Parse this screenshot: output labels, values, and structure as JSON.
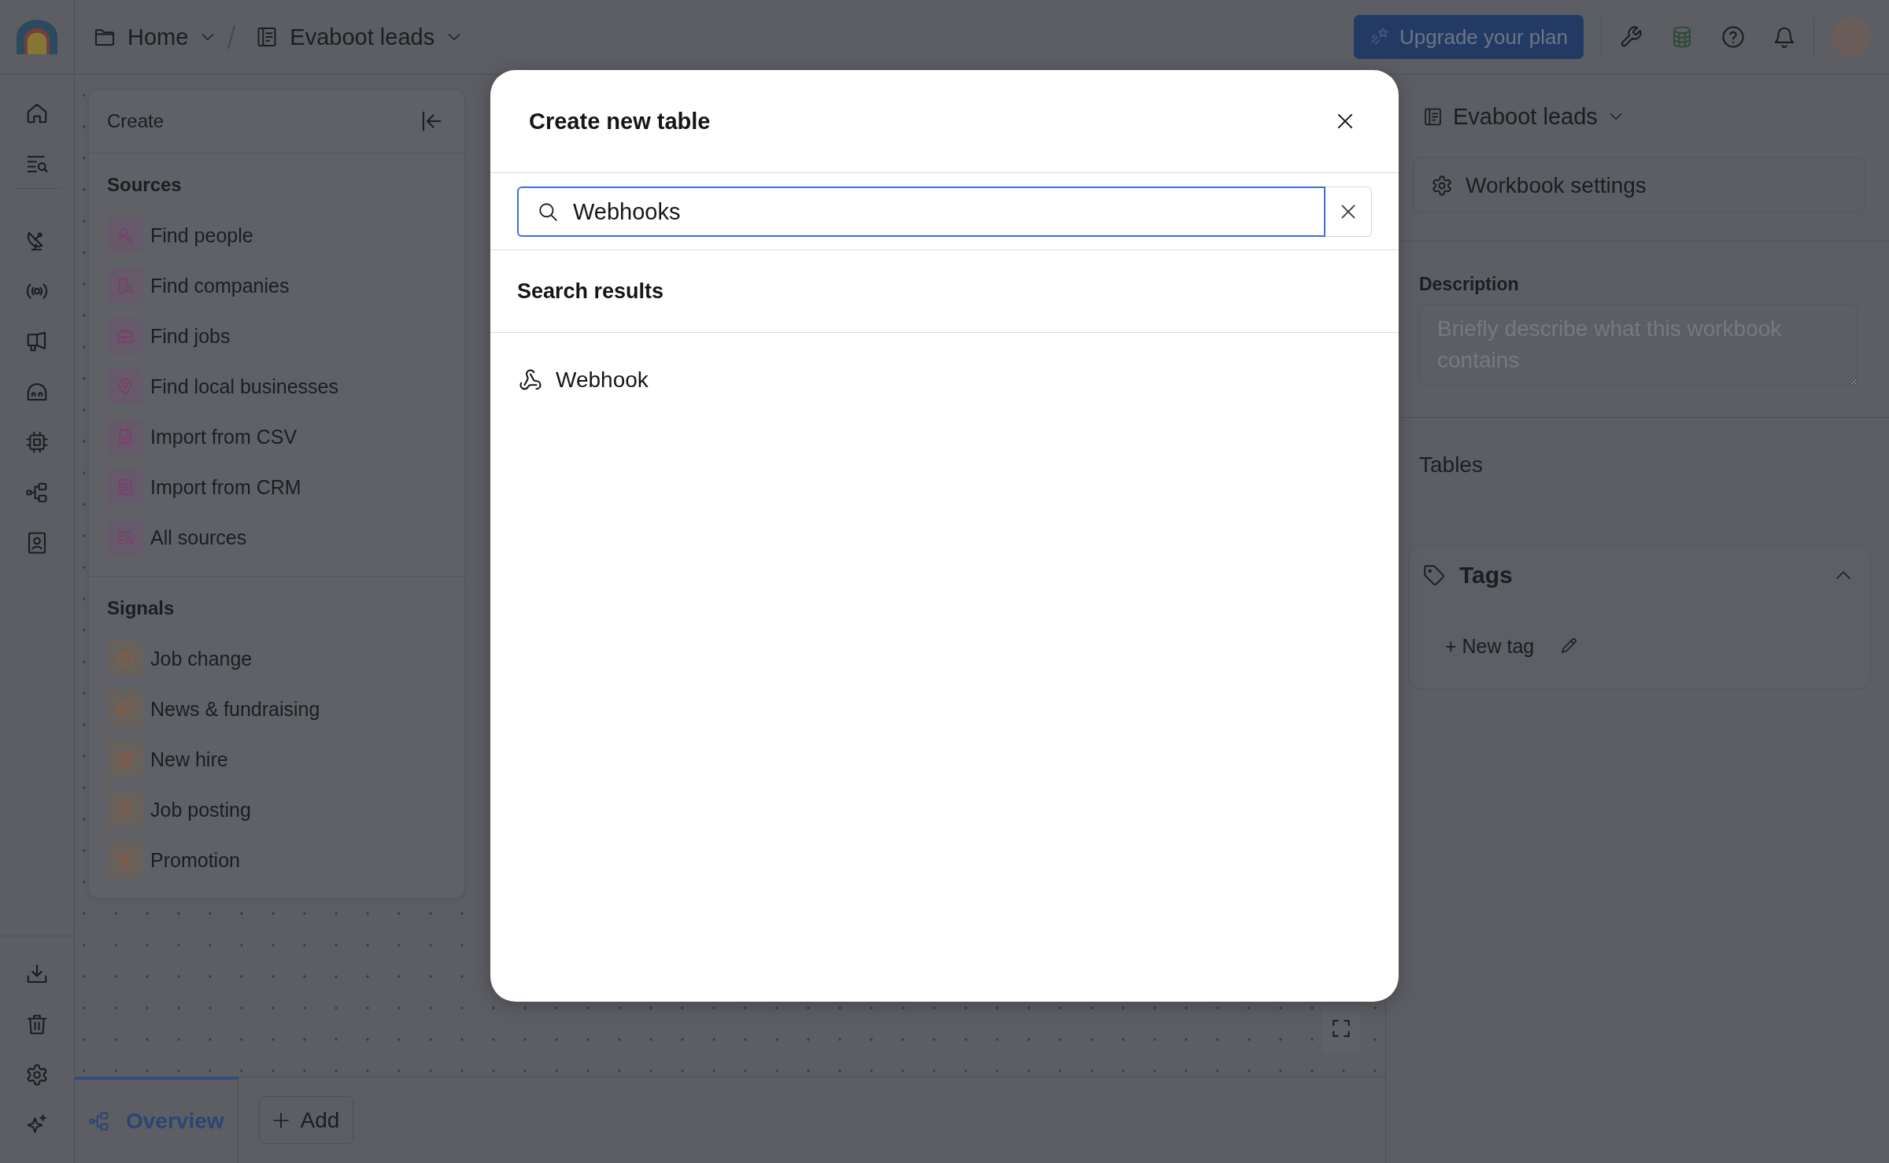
{
  "topbar": {
    "breadcrumb": [
      {
        "kind": "folder",
        "label": "Home"
      },
      {
        "kind": "notebook",
        "label": "Evaboot leads"
      }
    ],
    "upgrade_button": "Upgrade your plan"
  },
  "create_panel": {
    "title": "Create",
    "sections": [
      {
        "kind": "source",
        "title": "Sources",
        "items": [
          "Find people",
          "Find companies",
          "Find jobs",
          "Find local businesses",
          "Import from CSV",
          "Import from CRM",
          "All sources"
        ]
      },
      {
        "kind": "signal",
        "title": "Signals",
        "items": [
          "Job change",
          "News & fundraising",
          "New hire",
          "Job posting",
          "Promotion"
        ]
      }
    ]
  },
  "modal": {
    "title": "Create new table",
    "search": {
      "value": "Webhooks"
    },
    "results_heading": "Search results",
    "results": [
      {
        "label": "Webhook"
      }
    ]
  },
  "right_panel": {
    "title": "Evaboot leads",
    "settings_button": "Workbook settings",
    "description": {
      "label": "Description",
      "placeholder": "Briefly describe what this workbook contains"
    },
    "tables_heading": "Tables",
    "tags": {
      "title": "Tags",
      "expanded": true,
      "new_tag_button": "+ New tag"
    }
  },
  "bottom_bar": {
    "tabs": [
      {
        "label": "Overview",
        "selected": true
      }
    ],
    "add_button": "Add"
  }
}
